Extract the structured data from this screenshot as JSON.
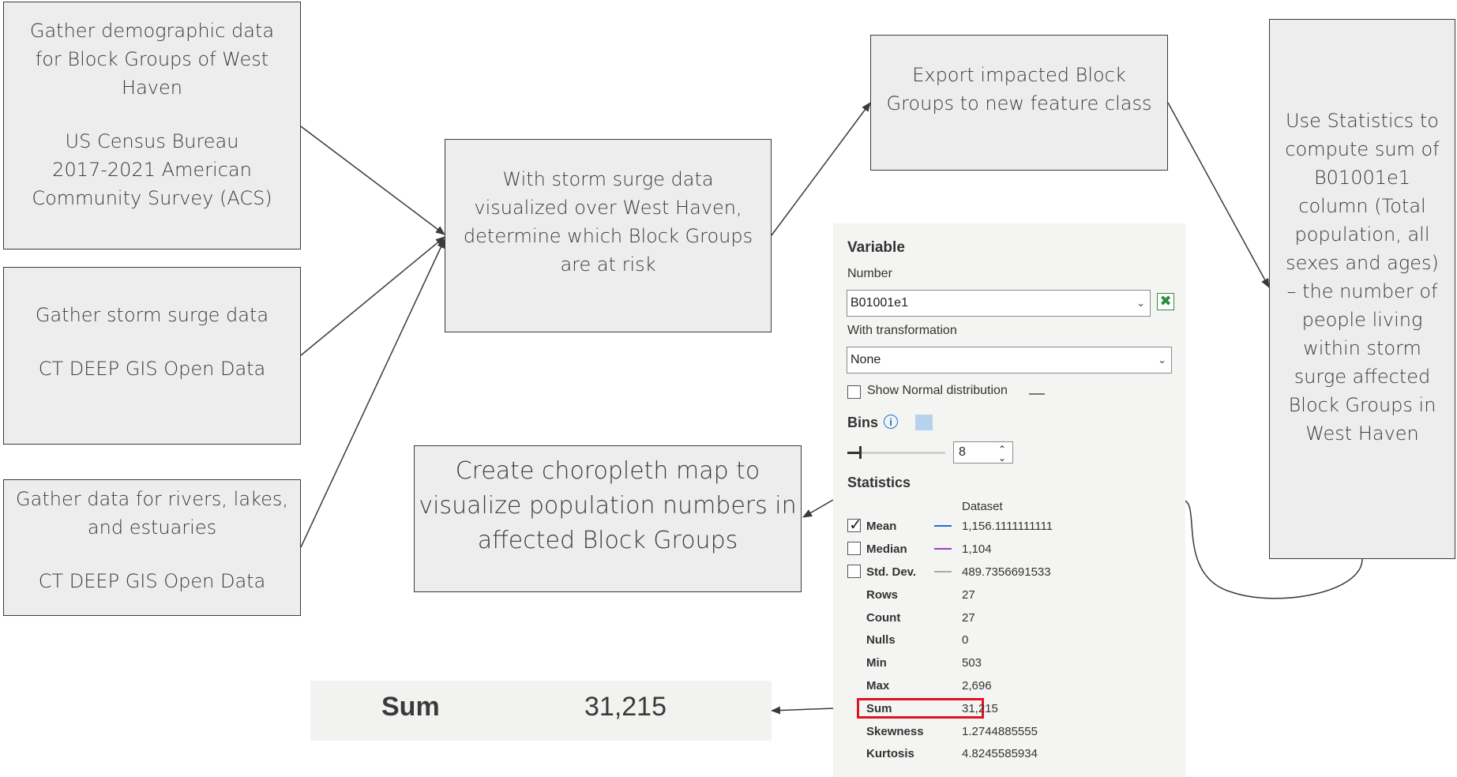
{
  "boxes": {
    "demographic": {
      "lines": [
        "Gather demographic data",
        "for Block Groups of West",
        "Haven"
      ],
      "source_lines": [
        "US Census Bureau",
        "2017-2021 American",
        "Community Survey (ACS)"
      ]
    },
    "storm_surge": {
      "line": "Gather storm surge data",
      "source": "CT DEEP GIS Open Data"
    },
    "rivers": {
      "lines": [
        "Gather data for rivers, lakes,",
        "and estuaries"
      ],
      "source": "CT DEEP GIS Open Data"
    },
    "determine": {
      "lines": [
        "With storm surge data",
        "visualized over West Haven,",
        "determine which Block Groups",
        "are at risk"
      ]
    },
    "export": {
      "lines": [
        "Export impacted Block",
        "Groups to new feature class"
      ]
    },
    "statistics": {
      "lines": [
        "Use Statistics to",
        "compute sum of",
        "B01001e1",
        "column (Total",
        "population, all",
        "sexes and ages)",
        "– the number of",
        "people living",
        "within storm",
        "surge affected",
        "Block Groups in",
        "West Haven"
      ]
    },
    "choropleth": {
      "lines": [
        "Create choropleth map to",
        "visualize population numbers in",
        "affected Block Groups"
      ]
    }
  },
  "stats_panel": {
    "variable_heading": "Variable",
    "number_label": "Number",
    "number_value": "B01001e1",
    "transformation_label": "With transformation",
    "transformation_value": "None",
    "show_normal_label": "Show Normal distribution",
    "bins_label": "Bins",
    "bins_value": "8",
    "statistics_heading": "Statistics",
    "dataset_header": "Dataset",
    "checked_rows": [
      {
        "label": "Mean",
        "value": "1,156.1111111111",
        "checked": true,
        "color": "#1f6fd6"
      },
      {
        "label": "Median",
        "value": "1,104",
        "checked": false,
        "color": "#9b3fc0"
      },
      {
        "label": "Std. Dev.",
        "value": "489.7356691533",
        "checked": false,
        "color": "#a9a9a9"
      }
    ],
    "rows": [
      {
        "label": "Rows",
        "value": "27"
      },
      {
        "label": "Count",
        "value": "27"
      },
      {
        "label": "Nulls",
        "value": "0"
      },
      {
        "label": "Min",
        "value": "503"
      },
      {
        "label": "Max",
        "value": "2,696"
      },
      {
        "label": "Sum",
        "value": "31,215"
      },
      {
        "label": "Skewness",
        "value": "1.2744885555"
      },
      {
        "label": "Kurtosis",
        "value": "4.8245585934"
      }
    ],
    "highlight_color": "#e0141e"
  },
  "sum_zoom": {
    "label": "Sum",
    "value": "31,215"
  }
}
